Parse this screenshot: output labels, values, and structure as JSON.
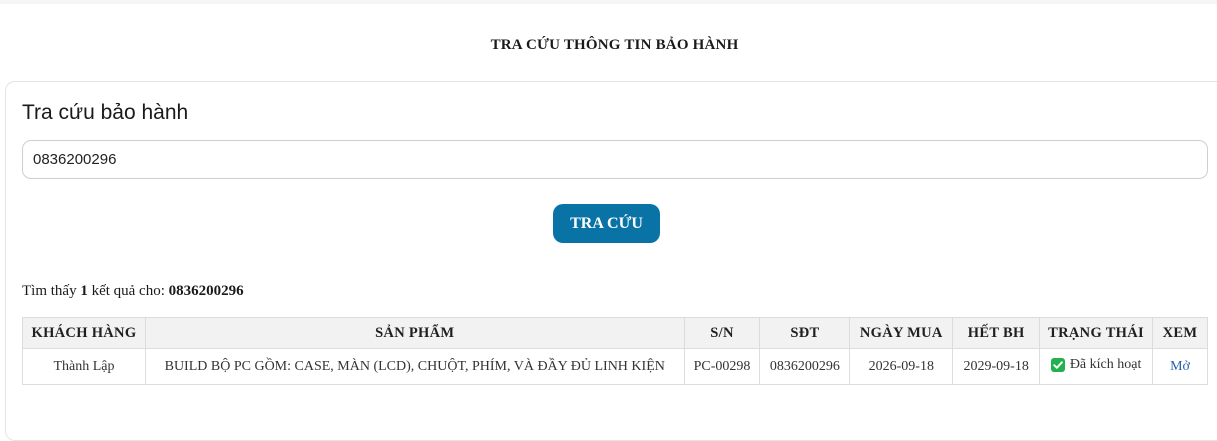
{
  "page": {
    "title": "TRA CỨU THÔNG TIN BẢO HÀNH"
  },
  "search": {
    "card_title": "Tra cứu bảo hành",
    "input_value": "0836200296",
    "button_label": "TRA CỨU"
  },
  "results": {
    "summary_prefix": "Tìm thấy",
    "count": "1",
    "summary_middle": "kết quả cho:",
    "query": "0836200296",
    "columns": [
      "KHÁCH HÀNG",
      "SẢN PHẨM",
      "S/N",
      "SĐT",
      "NGÀY MUA",
      "HẾT BH",
      "TRẠNG THÁI",
      "XEM"
    ],
    "rows": [
      {
        "customer": "Thành Lập",
        "product": "BUILD BỘ PC GỒM: CASE, MÀN (LCD), CHUỘT, PHÍM, VÀ ĐẦY ĐỦ LINH KIỆN",
        "serial": "PC-00298",
        "phone": "0836200296",
        "purchase_date": "2026-09-18",
        "warranty_end": "2029-09-18",
        "status": "Đã kích hoạt",
        "status_icon": "check-square-icon",
        "view_label": "Mở"
      }
    ]
  },
  "colors": {
    "accent": "#0a73a6",
    "status_green": "#22b050",
    "link": "#2a5fa8"
  }
}
